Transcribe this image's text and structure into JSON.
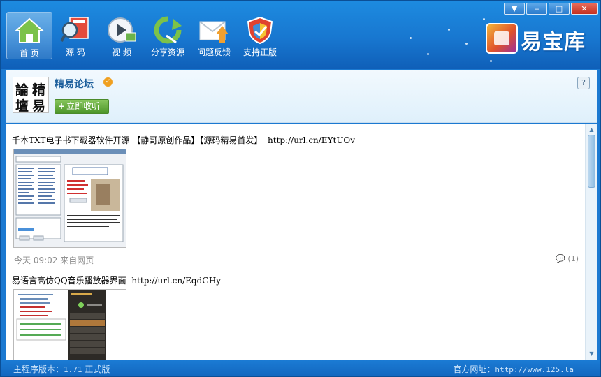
{
  "window_controls": {
    "menu": "▼",
    "minimize": "‒",
    "maximize": "□",
    "close": "✕"
  },
  "nav": [
    {
      "label": "首  页",
      "icon": "home-icon",
      "active": true
    },
    {
      "label": "源  码",
      "icon": "source-code-icon",
      "active": false
    },
    {
      "label": "视  频",
      "icon": "video-icon",
      "active": false
    },
    {
      "label": "分享资源",
      "icon": "share-resources-icon",
      "active": false
    },
    {
      "label": "问题反馈",
      "icon": "feedback-mail-icon",
      "active": false
    },
    {
      "label": "支持正版",
      "icon": "shield-icon",
      "active": false
    }
  ],
  "logo": {
    "title": "易宝库"
  },
  "profile": {
    "avatar_text": [
      "論",
      "精",
      "壇",
      "易"
    ],
    "name": "精易论坛",
    "verified_mark": "✓",
    "listen_plus": "+",
    "listen_label": "立即收听",
    "help_icon": "?"
  },
  "posts": [
    {
      "text": "千本TXT电子书下载器软件开源 【静哥原创作品】【源码精易首发】",
      "url": "http://url.cn/EYtUOv",
      "time": "今天  09:02",
      "source": "来自网页",
      "comments_icon": "💬",
      "comments": "(1)"
    },
    {
      "text": "易语言高仿QQ音乐播放器界面",
      "url": "http://url.cn/EqdGHy"
    }
  ],
  "scrollbar": {
    "up": "▲",
    "down": "▼"
  },
  "status": {
    "version_label": "主程序版本：",
    "version_value": "1.71",
    "edition": "正式版",
    "site_label": "官方网址：",
    "site_value": "http://www.125.la"
  },
  "colors": {
    "header_blue": "#1877d0",
    "status_blue": "#1367bf",
    "listen_green": "#4d962a",
    "name_blue": "#1c5f9c",
    "close_red": "#c4301f"
  }
}
